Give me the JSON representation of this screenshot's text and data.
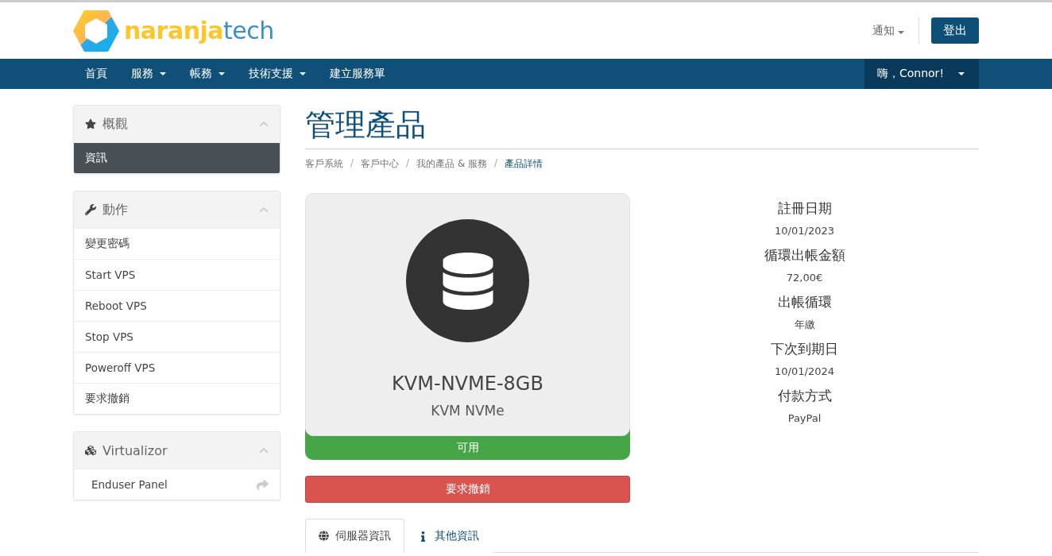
{
  "header": {
    "logo": {
      "part_1": "naranja",
      "part_2": "tech"
    },
    "notifications": "通知",
    "logout": "登出"
  },
  "nav": {
    "items": [
      {
        "label": "首頁",
        "dropdown": false
      },
      {
        "label": "服務",
        "dropdown": true
      },
      {
        "label": "帳務",
        "dropdown": true
      },
      {
        "label": "技術支援",
        "dropdown": true
      },
      {
        "label": "建立服務單",
        "dropdown": false
      }
    ],
    "user": "嗨，Connor!"
  },
  "sidebar": [
    {
      "title": "概觀",
      "items": [
        {
          "label": "資訊",
          "selected": true,
          "link_icon": false
        }
      ]
    },
    {
      "title": "動作",
      "items": [
        {
          "label": "變更密碼",
          "selected": false,
          "link_icon": false
        },
        {
          "label": "Start VPS",
          "selected": false,
          "link_icon": false
        },
        {
          "label": "Reboot VPS",
          "selected": false,
          "link_icon": false
        },
        {
          "label": "Stop VPS",
          "selected": false,
          "link_icon": false
        },
        {
          "label": "Poweroff VPS",
          "selected": false,
          "link_icon": false
        },
        {
          "label": "要求撤銷",
          "selected": false,
          "link_icon": false
        }
      ]
    },
    {
      "title": "Virtualizor",
      "items": [
        {
          "label": "Enduser Panel",
          "selected": false,
          "link_icon": true
        }
      ]
    }
  ],
  "page_title": "管理產品",
  "breadcrumb": [
    {
      "label": "客戶系統",
      "current": false
    },
    {
      "separator": "/",
      "label": "客戶中心",
      "current": false
    },
    {
      "separator": "/",
      "label": "我的產品 & 服務",
      "current": false
    },
    {
      "separator": "/",
      "label": "產品詳情",
      "current": true
    }
  ],
  "product": {
    "name": "KVM-NVME-8GB",
    "group": "KVM NVMe",
    "status": "可用"
  },
  "cancel_button": "要求撤銷",
  "details": [
    {
      "label": "註冊日期",
      "value": "10/01/2023"
    },
    {
      "label": "循環出帳金額",
      "value": "72,00€"
    },
    {
      "label": "出帳循環",
      "value": "年繳"
    },
    {
      "label": "下次到期日",
      "value": "10/01/2024"
    },
    {
      "label": "付款方式",
      "value": "PayPal"
    }
  ],
  "tabs": [
    {
      "label": "伺服器資訊",
      "selected": true
    },
    {
      "label": "其他資訊",
      "selected": false
    }
  ]
}
